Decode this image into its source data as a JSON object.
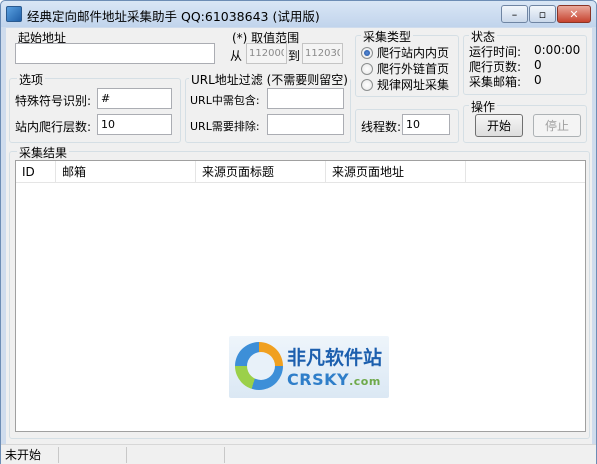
{
  "window": {
    "title": "经典定向邮件地址采集助手 QQ:61038643 (试用版)",
    "buttons": {
      "minimize": "–",
      "maximize": "▫",
      "close": "✕"
    }
  },
  "start_address": {
    "label": "起始地址",
    "value": ""
  },
  "range": {
    "label": "(*) 取值范围",
    "from_label": "从",
    "from_value": "112000",
    "to_label": "到",
    "to_value": "112030"
  },
  "collect_type": {
    "label": "采集类型",
    "options": [
      "爬行站内内页",
      "爬行外链首页",
      "规律网址采集"
    ],
    "selected": 0
  },
  "status": {
    "label": "状态",
    "rows": [
      {
        "key": "运行时间:",
        "value": "0:00:00"
      },
      {
        "key": "爬行页数:",
        "value": "0"
      },
      {
        "key": "采集邮箱:",
        "value": "0"
      }
    ]
  },
  "options": {
    "label": "选项",
    "special_char_label": "特殊符号识别:",
    "special_char_value": "#",
    "depth_label": "站内爬行层数:",
    "depth_value": "10"
  },
  "url_filter": {
    "label": "URL地址过滤 (不需要则留空)",
    "include_label": "URL中需包含:",
    "include_value": "",
    "exclude_label": "URL需要排除:",
    "exclude_value": ""
  },
  "threads": {
    "label": "线程数:",
    "value": "10"
  },
  "actions": {
    "label": "操作",
    "start": "开始",
    "stop": "停止"
  },
  "results": {
    "label": "采集结果",
    "columns": [
      "ID",
      "邮箱",
      "来源页面标题",
      "来源页面地址"
    ],
    "rows": []
  },
  "watermark": {
    "cn": "非凡软件站",
    "en": "CRSKY",
    "en_suffix": ".com"
  },
  "statusbar": {
    "text": "未开始"
  },
  "colors": {
    "titlebar": "#c1d4ec",
    "client": "#f0f0f0",
    "brand_blue": "#1c5fae"
  }
}
